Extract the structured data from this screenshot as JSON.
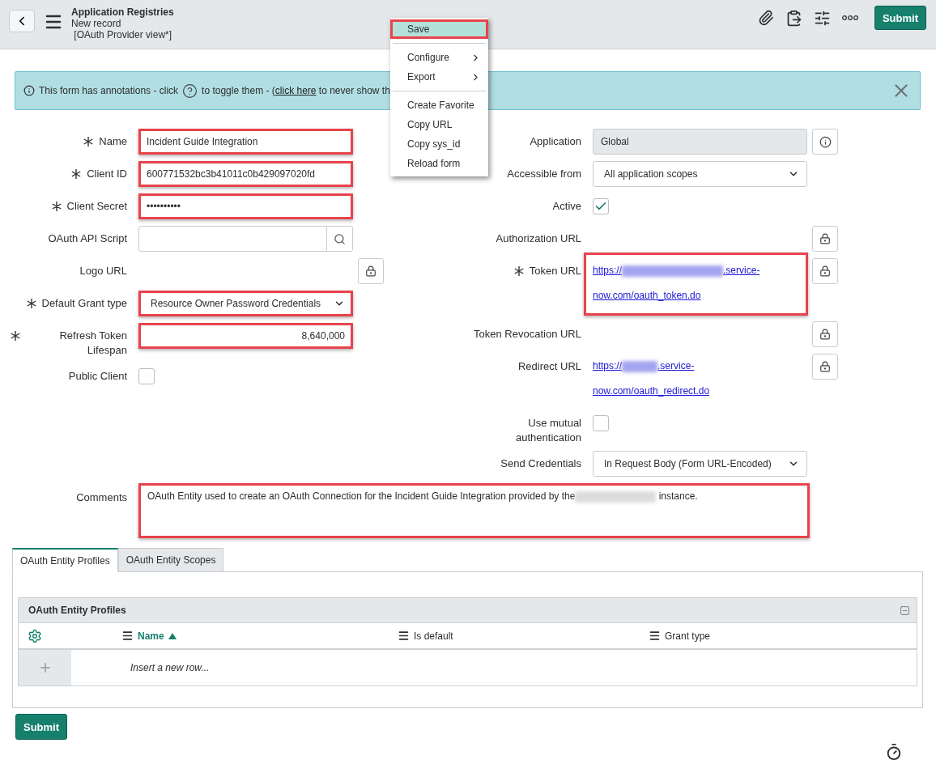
{
  "header": {
    "title": "Application Registries",
    "subtitle": "New record",
    "view": "[OAuth Provider view*]",
    "submit": "Submit"
  },
  "context_menu": [
    {
      "kind": "item",
      "label": "Save",
      "selected": true,
      "highlighted": true
    },
    {
      "kind": "divider"
    },
    {
      "kind": "submenu",
      "label": "Configure",
      "selected": false,
      "highlighted": false
    },
    {
      "kind": "submenu",
      "label": "Export",
      "selected": false,
      "highlighted": false
    },
    {
      "kind": "divider"
    },
    {
      "kind": "item",
      "label": "Create Favorite",
      "selected": false,
      "highlighted": false
    },
    {
      "kind": "item",
      "label": "Copy URL",
      "selected": false,
      "highlighted": false
    },
    {
      "kind": "item",
      "label": "Copy sys_id",
      "selected": false,
      "highlighted": false
    },
    {
      "kind": "item",
      "label": "Reload form",
      "selected": false,
      "highlighted": false
    }
  ],
  "banner": {
    "text_before": "This form has annotations - click",
    "text_after": "to toggle them - (",
    "link": "click here",
    "text_end": "to never show th"
  },
  "left_fields": [
    {
      "kind": "text",
      "label": "Name",
      "required": true,
      "value": "Incident Guide Integration",
      "highlighted": true
    },
    {
      "kind": "text",
      "label": "Client ID",
      "required": true,
      "value": "600771532bc3b41011c0b429097020fd",
      "highlighted": true
    },
    {
      "kind": "text",
      "label": "Client Secret",
      "required": true,
      "value": "••••••••••",
      "highlighted": true
    },
    {
      "kind": "reference",
      "label": "OAuth API Script",
      "required": false
    },
    {
      "kind": "locked",
      "label": "Logo URL",
      "required": false
    },
    {
      "kind": "select",
      "label": "Default Grant type",
      "required": true,
      "value": "Resource Owner Password Credentials",
      "highlighted": true
    },
    {
      "kind": "number",
      "label": "Refresh Token Lifespan",
      "required": true,
      "value": "8,640,000",
      "highlighted": true
    },
    {
      "kind": "checkbox",
      "label": "Public Client",
      "required": false,
      "checked": false
    }
  ],
  "right_fields": [
    {
      "kind": "readonly",
      "label": "Application",
      "required": false,
      "value": "Global"
    },
    {
      "kind": "select",
      "label": "Accessible from",
      "required": false,
      "value": "All application scopes",
      "highlighted": false
    },
    {
      "kind": "checkbox",
      "label": "Active",
      "required": false,
      "checked": true
    },
    {
      "kind": "locked",
      "label": "Authorization URL",
      "required": false
    },
    {
      "kind": "url",
      "label": "Token URL",
      "required": true,
      "url_start": "https://",
      "url_mid": ".service-",
      "url_end": "now.com/oauth_token.do",
      "highlighted": true
    },
    {
      "kind": "locked",
      "label": "Token Revocation URL",
      "required": false
    },
    {
      "kind": "url",
      "label": "Redirect URL",
      "required": false,
      "url_start": "https://",
      "url_mid": ".service-",
      "url_end": "now.com/oauth_redirect.do",
      "highlighted": false
    },
    {
      "kind": "checkbox",
      "label": "Use mutual authentication",
      "required": false,
      "checked": false
    },
    {
      "kind": "select",
      "label": "Send Credentials",
      "required": false,
      "value": "In Request Body (Form URL-Encoded)",
      "highlighted": false
    }
  ],
  "comments": {
    "label": "Comments",
    "text_before": "OAuth Entity used to create an OAuth Connection for the Incident Guide Integration provided by the",
    "text_after": "instance.",
    "highlighted": true
  },
  "tabs": [
    {
      "label": "OAuth Entity Profiles",
      "selected": true
    },
    {
      "label": "OAuth Entity Scopes",
      "selected": false
    }
  ],
  "related_list": {
    "title": "OAuth Entity Profiles",
    "columns": [
      {
        "label": "Name",
        "sorted": true
      },
      {
        "label": "Is default",
        "sorted": false
      },
      {
        "label": "Grant type",
        "sorted": false
      }
    ],
    "insert_row": "Insert a new row..."
  },
  "footer": {
    "submit": "Submit"
  }
}
